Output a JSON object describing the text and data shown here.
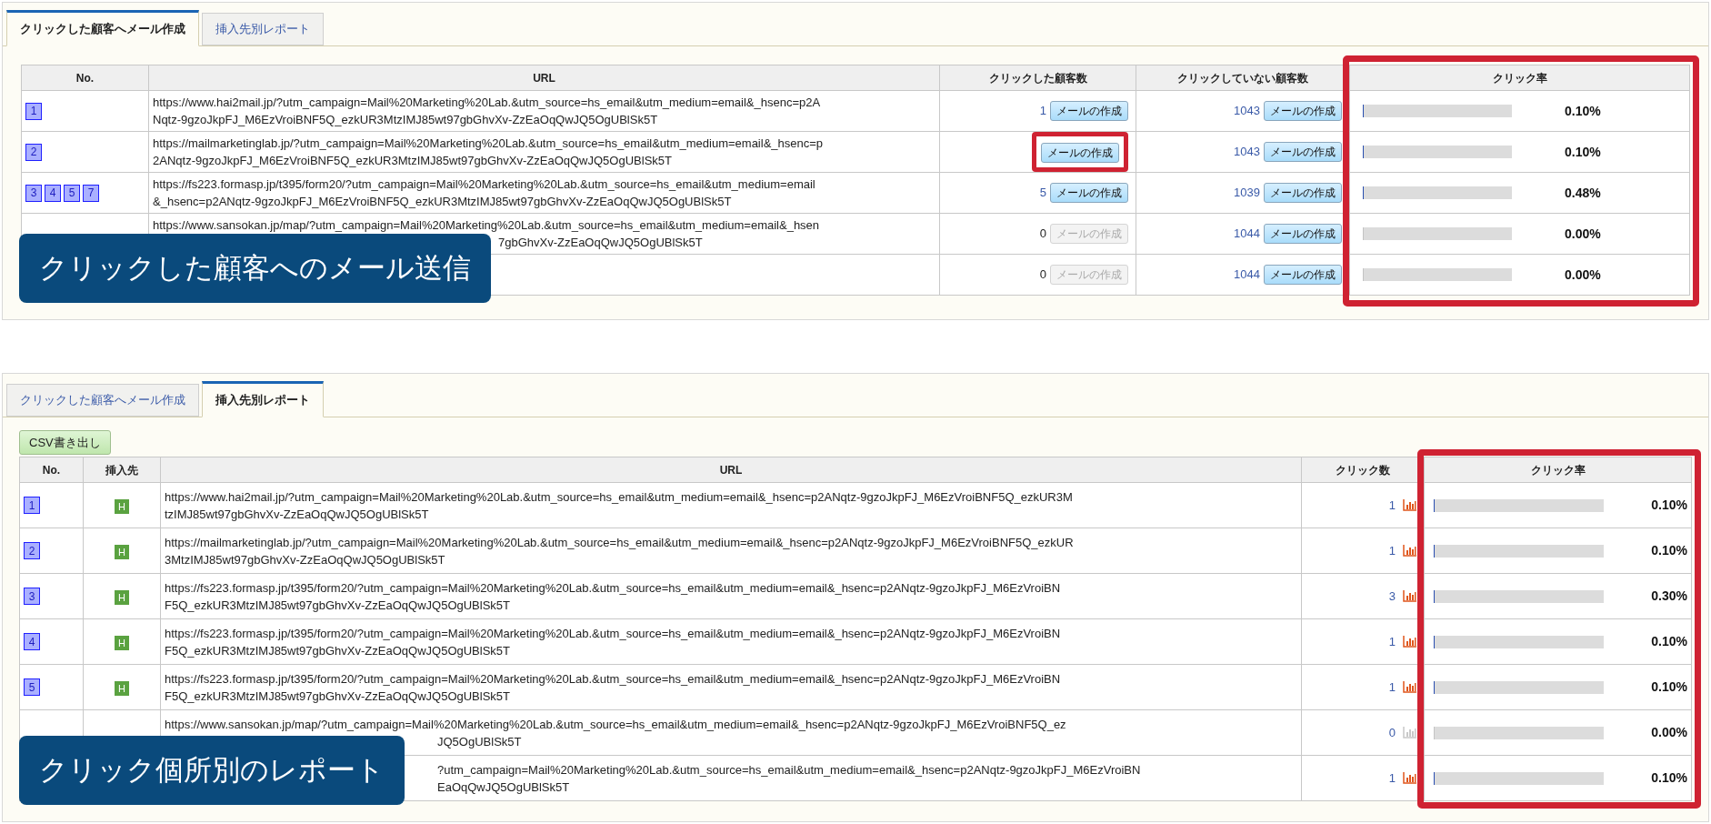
{
  "panels": [
    {
      "kind": "mail",
      "tabs": [
        {
          "label": "クリックした顧客へメール作成",
          "selected": true
        },
        {
          "label": "挿入先別レポート",
          "selected": false
        }
      ],
      "columns": [
        "No.",
        "URL",
        "クリックした顧客数",
        "クリックしていない顧客数",
        "クリック率"
      ],
      "rows": [
        {
          "numbers": [
            "1"
          ],
          "url": [
            {
              "kind": "line",
              "text": "https://www.hai2mail.jp/?utm_campaign=Mail%20Marketing%20Lab.&utm_source=hs_email&utm_medium=email&_hsenc=p2A"
            },
            {
              "kind": "line",
              "text": "Nqtz-9gzoJkpFJ_M6EzVroiBNF5Q_ezkUR3MtzIMJ85wt97gbGhvXv-ZzEaOqQwJQ5OgUBlSk5T"
            }
          ],
          "clicked": {
            "count": "1",
            "button": "メールの作成",
            "disabled": false,
            "highlighted": false
          },
          "not_clicked": {
            "count": "1043",
            "button": "メールの作成",
            "disabled": false
          },
          "level": 0.001,
          "rate": "0.10%"
        },
        {
          "numbers": [
            "2"
          ],
          "url": [
            {
              "kind": "line",
              "text": "https://mailmarketinglab.jp/?utm_campaign=Mail%20Marketing%20Lab.&utm_source=hs_email&utm_medium=email&_hsenc=p"
            },
            {
              "kind": "line",
              "text": "2ANqtz-9gzoJkpFJ_M6EzVroiBNF5Q_ezkUR3MtzIMJ85wt97gbGhvXv-ZzEaOqQwJQ5OgUBlSk5T"
            }
          ],
          "clicked": {
            "button": "メールの作成",
            "disabled": false,
            "highlighted": true
          },
          "not_clicked": {
            "count": "1043",
            "button": "メールの作成",
            "disabled": false
          },
          "level": 0.001,
          "rate": "0.10%"
        },
        {
          "numbers": [
            "3",
            "4",
            "5",
            "7"
          ],
          "url": [
            {
              "kind": "line",
              "text": "https://fs223.formasp.jp/t395/form20/?utm_campaign=Mail%20Marketing%20Lab.&utm_source=hs_email&utm_medium=email"
            },
            {
              "kind": "line",
              "text": "&_hsenc=p2ANqtz-9gzoJkpFJ_M6EzVroiBNF5Q_ezkUR3MtzIMJ85wt97gbGhvXv-ZzEaOqQwJQ5OgUBlSk5T"
            }
          ],
          "clicked": {
            "count": "5",
            "button": "メールの作成",
            "disabled": false,
            "highlighted": false
          },
          "not_clicked": {
            "count": "1039",
            "button": "メールの作成",
            "disabled": false
          },
          "level": 0.0048,
          "rate": "0.48%"
        },
        {
          "url": [
            {
              "kind": "line",
              "text": "https://www.sansokan.jp/map/?utm_campaign=Mail%20Marketing%20Lab.&utm_source=hs_email&utm_medium=email&_hsen"
            },
            {
              "kind": "tail",
              "text": "7gbGhvXv-ZzEaOqQwJQ5OgUBlSk5T"
            }
          ],
          "clicked": {
            "count": "0",
            "button": "メールの作成",
            "disabled": true,
            "highlighted": false
          },
          "not_clicked": {
            "count": "1044",
            "button": "メールの作成",
            "disabled": false
          },
          "level": 0,
          "rate": "0.00%"
        },
        {
          "clicked": {
            "count": "0",
            "button": "メールの作成",
            "disabled": true,
            "highlighted": false
          },
          "not_clicked": {
            "count": "1044",
            "button": "メールの作成",
            "disabled": false
          },
          "level": 0,
          "rate": "0.00%"
        }
      ],
      "callout": "クリックした顧客へのメール送信"
    },
    {
      "kind": "report",
      "tabs": [
        {
          "label": "クリックした顧客へメール作成",
          "selected": false
        },
        {
          "label": "挿入先別レポート",
          "selected": true
        }
      ],
      "csv_button": "CSV書き出し",
      "columns": [
        "No.",
        "挿入先",
        "URL",
        "クリック数",
        "クリック率"
      ],
      "rows": [
        {
          "numbers": [
            "1"
          ],
          "badge": "H",
          "url": [
            {
              "kind": "line",
              "text": "https://www.hai2mail.jp/?utm_campaign=Mail%20Marketing%20Lab.&utm_source=hs_email&utm_medium=email&_hsenc=p2ANqtz-9gzoJkpFJ_M6EzVroiBNF5Q_ezkUR3M"
            },
            {
              "kind": "line",
              "text": "tzIMJ85wt97gbGhvXv-ZzEaOqQwJQ5OgUBlSk5T"
            }
          ],
          "count": "1",
          "graph_disabled": false,
          "level": 0.001,
          "rate": "0.10%"
        },
        {
          "numbers": [
            "2"
          ],
          "badge": "H",
          "url": [
            {
              "kind": "line",
              "text": "https://mailmarketinglab.jp/?utm_campaign=Mail%20Marketing%20Lab.&utm_source=hs_email&utm_medium=email&_hsenc=p2ANqtz-9gzoJkpFJ_M6EzVroiBNF5Q_ezkUR"
            },
            {
              "kind": "line",
              "text": "3MtzIMJ85wt97gbGhvXv-ZzEaOqQwJQ5OgUBlSk5T"
            }
          ],
          "count": "1",
          "graph_disabled": false,
          "level": 0.001,
          "rate": "0.10%"
        },
        {
          "numbers": [
            "3"
          ],
          "badge": "H",
          "url": [
            {
              "kind": "line",
              "text": "https://fs223.formasp.jp/t395/form20/?utm_campaign=Mail%20Marketing%20Lab.&utm_source=hs_email&utm_medium=email&_hsenc=p2ANqtz-9gzoJkpFJ_M6EzVroiBN"
            },
            {
              "kind": "line",
              "text": "F5Q_ezkUR3MtzIMJ85wt97gbGhvXv-ZzEaOqQwJQ5OgUBlSk5T"
            }
          ],
          "count": "3",
          "graph_disabled": false,
          "level": 0.003,
          "rate": "0.30%"
        },
        {
          "numbers": [
            "4"
          ],
          "badge": "H",
          "url": [
            {
              "kind": "line",
              "text": "https://fs223.formasp.jp/t395/form20/?utm_campaign=Mail%20Marketing%20Lab.&utm_source=hs_email&utm_medium=email&_hsenc=p2ANqtz-9gzoJkpFJ_M6EzVroiBN"
            },
            {
              "kind": "line",
              "text": "F5Q_ezkUR3MtzIMJ85wt97gbGhvXv-ZzEaOqQwJQ5OgUBlSk5T"
            }
          ],
          "count": "1",
          "graph_disabled": false,
          "level": 0.001,
          "rate": "0.10%"
        },
        {
          "numbers": [
            "5"
          ],
          "badge": "H",
          "url": [
            {
              "kind": "line",
              "text": "https://fs223.formasp.jp/t395/form20/?utm_campaign=Mail%20Marketing%20Lab.&utm_source=hs_email&utm_medium=email&_hsenc=p2ANqtz-9gzoJkpFJ_M6EzVroiBN"
            },
            {
              "kind": "line",
              "text": "F5Q_ezkUR3MtzIMJ85wt97gbGhvXv-ZzEaOqQwJQ5OgUBlSk5T"
            }
          ],
          "count": "1",
          "graph_disabled": false,
          "level": 0.001,
          "rate": "0.10%"
        },
        {
          "url": [
            {
              "kind": "line",
              "text": "https://www.sansokan.jp/map/?utm_campaign=Mail%20Marketing%20Lab.&utm_source=hs_email&utm_medium=email&_hsenc=p2ANqtz-9gzoJkpFJ_M6EzVroiBNF5Q_ez"
            },
            {
              "kind": "tail",
              "text": "JQ5OgUBlSk5T"
            }
          ],
          "count": "0",
          "graph_disabled": true,
          "level": 0,
          "rate": "0.00%"
        },
        {
          "url": [
            {
              "kind": "tail",
              "text": "?utm_campaign=Mail%20Marketing%20Lab.&utm_source=hs_email&utm_medium=email&_hsenc=p2ANqtz-9gzoJkpFJ_M6EzVroiBN"
            },
            {
              "kind": "tail",
              "text": "EaOqQwJQ5OgUBlSk5T"
            }
          ],
          "count": "1",
          "graph_disabled": false,
          "level": 0.001,
          "rate": "0.10%"
        }
      ],
      "callout": "クリック個所別のレポート"
    }
  ]
}
